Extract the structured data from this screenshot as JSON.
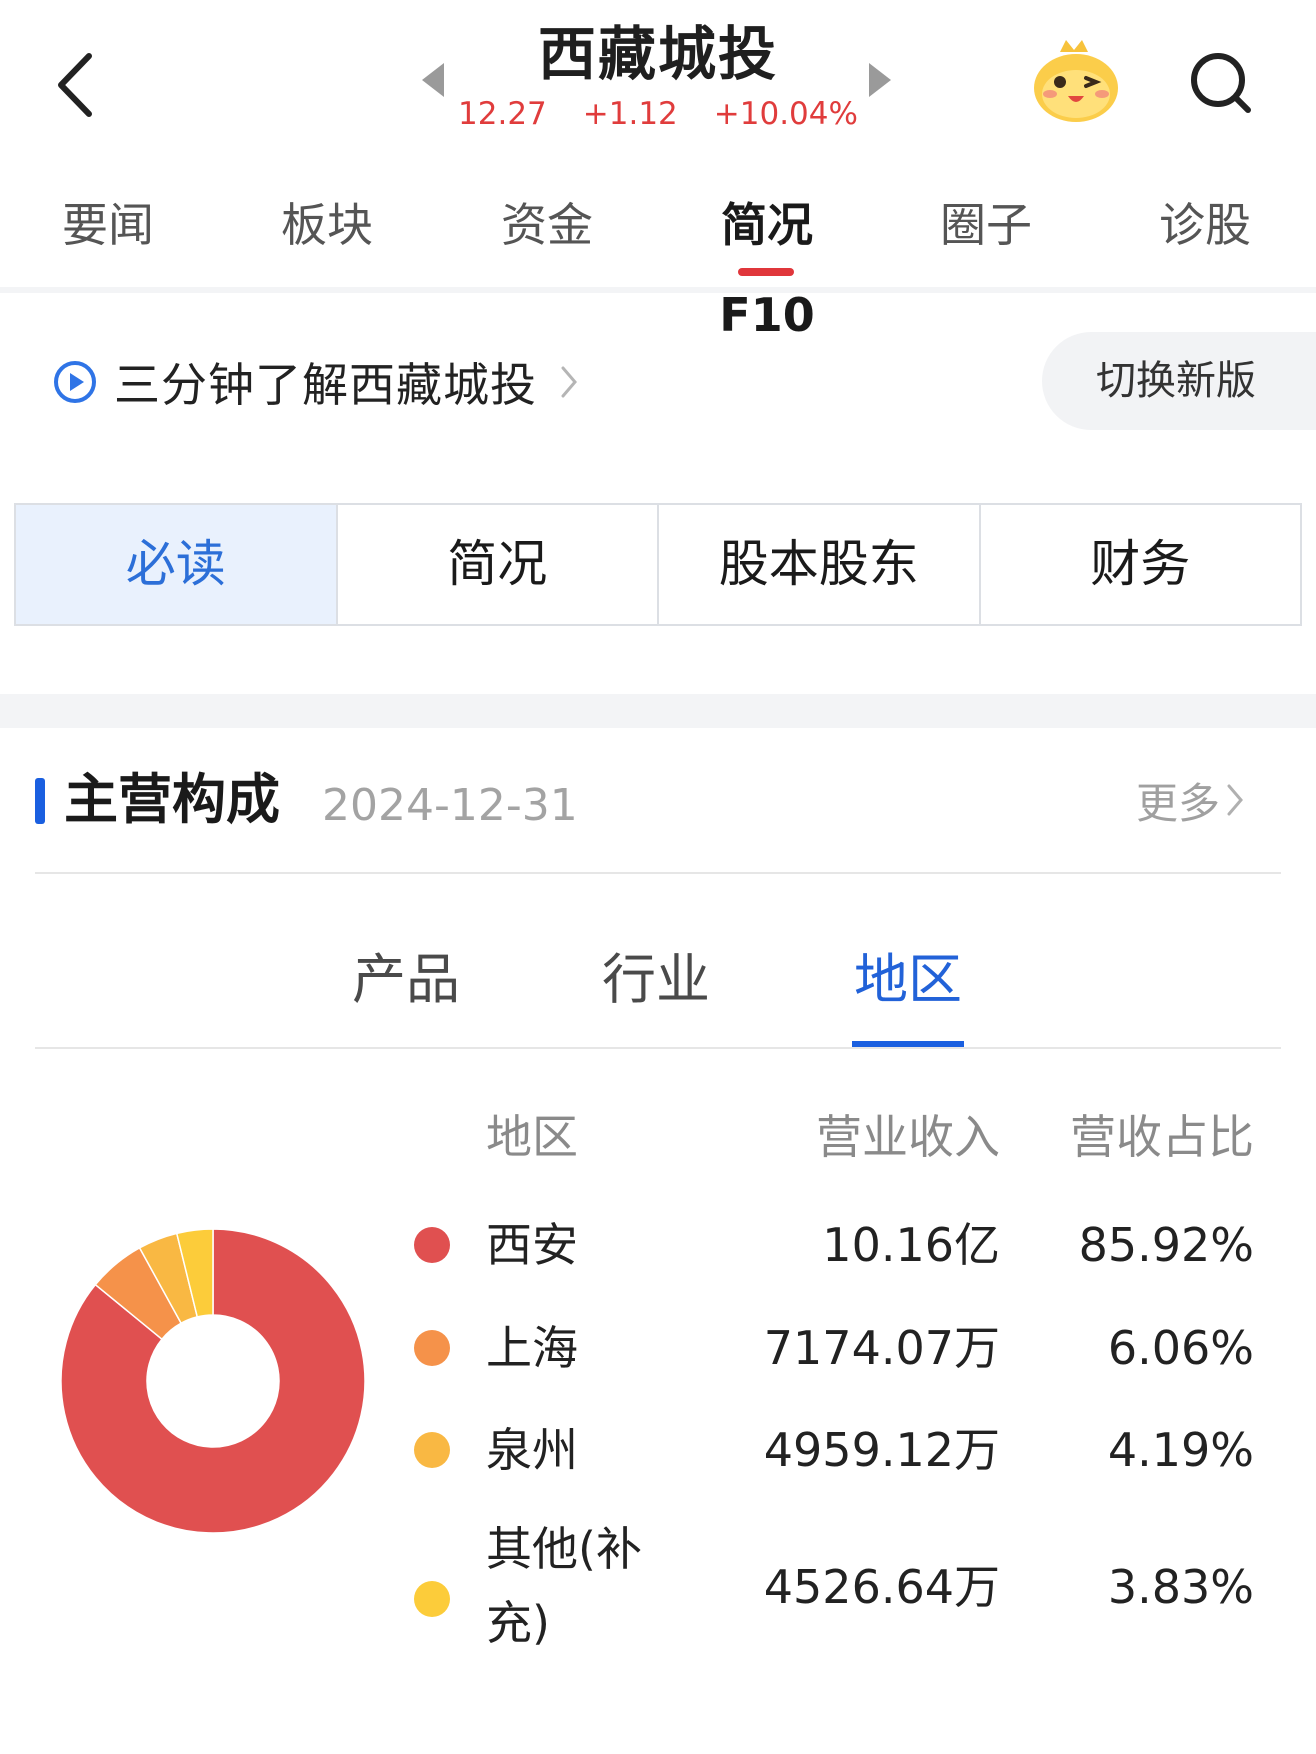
{
  "header": {
    "stock_name": "西藏城投",
    "price": "12.27",
    "change": "+1.12",
    "change_pct": "+10.04%",
    "up_color": "#e03c3c"
  },
  "main_tabs": [
    {
      "label": "要闻"
    },
    {
      "label": "板块"
    },
    {
      "label": "资金"
    },
    {
      "label": "简况F10",
      "active": true
    },
    {
      "label": "圈子"
    },
    {
      "label": "诊股"
    }
  ],
  "intro": {
    "text": "三分钟了解西藏城投",
    "switch_label": "切换新版"
  },
  "segments": [
    {
      "label": "必读",
      "active": true
    },
    {
      "label": "简况"
    },
    {
      "label": "股本股东"
    },
    {
      "label": "财务"
    }
  ],
  "section": {
    "title": "主营构成",
    "date": "2024-12-31",
    "more_label": "更多"
  },
  "sub_tabs": [
    {
      "label": "产品"
    },
    {
      "label": "行业"
    },
    {
      "label": "地区",
      "active": true
    }
  ],
  "table": {
    "headers": {
      "region": "地区",
      "revenue": "营业收入",
      "share": "营收占比"
    },
    "rows": [
      {
        "region": "西安",
        "revenue": "10.16亿",
        "share": "85.92%",
        "color": "#e05050"
      },
      {
        "region": "上海",
        "revenue": "7174.07万",
        "share": "6.06%",
        "color": "#f5924a"
      },
      {
        "region": "泉州",
        "revenue": "4959.12万",
        "share": "4.19%",
        "color": "#f9b843"
      },
      {
        "region": "其他(补充)",
        "revenue": "4526.64万",
        "share": "3.83%",
        "color": "#fccc3a"
      }
    ]
  },
  "chart_data": {
    "type": "pie",
    "categories": [
      "西安",
      "上海",
      "泉州",
      "其他(补充)"
    ],
    "values": [
      85.92,
      6.06,
      4.19,
      3.83
    ],
    "colors": [
      "#e05050",
      "#f5924a",
      "#f9b843",
      "#fccc3a"
    ],
    "donut": true
  }
}
